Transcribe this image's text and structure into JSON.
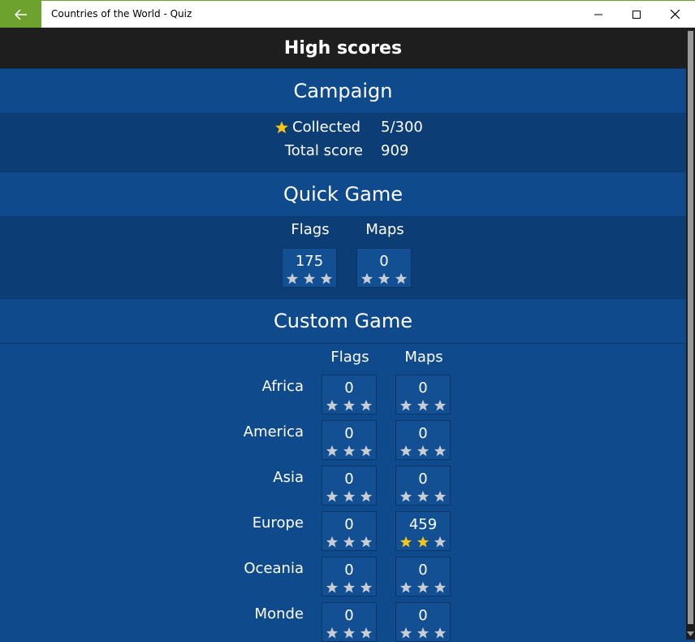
{
  "window": {
    "title": "Countries of the World - Quiz",
    "accent": "#6ea22e"
  },
  "header": {
    "title": "High scores"
  },
  "campaign": {
    "title": "Campaign",
    "collected_label": "Collected",
    "collected_value": "5/300",
    "total_label": "Total score",
    "total_value": "909"
  },
  "quick": {
    "title": "Quick Game",
    "flags_label": "Flags",
    "maps_label": "Maps",
    "flags": {
      "score": "175",
      "stars": 0
    },
    "maps": {
      "score": "0",
      "stars": 0
    }
  },
  "custom": {
    "title": "Custom Game",
    "flags_label": "Flags",
    "maps_label": "Maps",
    "rows": [
      {
        "region": "Africa",
        "flags": {
          "score": "0",
          "stars": 0
        },
        "maps": {
          "score": "0",
          "stars": 0
        }
      },
      {
        "region": "America",
        "flags": {
          "score": "0",
          "stars": 0
        },
        "maps": {
          "score": "0",
          "stars": 0
        }
      },
      {
        "region": "Asia",
        "flags": {
          "score": "0",
          "stars": 0
        },
        "maps": {
          "score": "0",
          "stars": 0
        }
      },
      {
        "region": "Europe",
        "flags": {
          "score": "0",
          "stars": 0
        },
        "maps": {
          "score": "459",
          "stars": 2
        }
      },
      {
        "region": "Oceania",
        "flags": {
          "score": "0",
          "stars": 0
        },
        "maps": {
          "score": "0",
          "stars": 0
        }
      },
      {
        "region": "Monde",
        "flags": {
          "score": "0",
          "stars": 0
        },
        "maps": {
          "score": "0",
          "stars": 0
        }
      }
    ]
  },
  "colors": {
    "star_filled": "#f5c518",
    "star_empty": "#c8ccd4",
    "section_head": "#0f4a8c",
    "section_body": "#0c3d74"
  }
}
